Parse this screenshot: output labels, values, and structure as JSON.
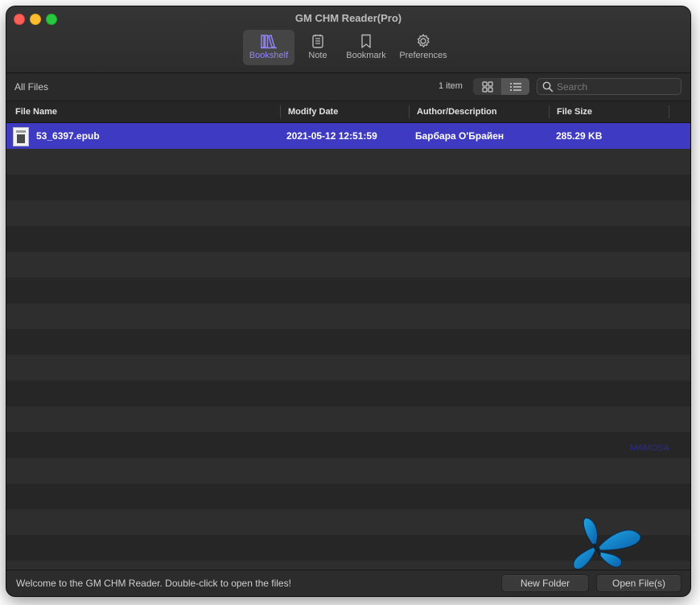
{
  "window": {
    "title": "GM CHM Reader(Pro)"
  },
  "toolbar": {
    "items": [
      {
        "label": "Bookshelf",
        "icon": "bookshelf-icon",
        "active": true
      },
      {
        "label": "Note",
        "icon": "note-icon",
        "active": false
      },
      {
        "label": "Bookmark",
        "icon": "bookmark-icon",
        "active": false
      },
      {
        "label": "Preferences",
        "icon": "gear-icon",
        "active": false
      }
    ]
  },
  "pathbar": {
    "breadcrumb": "All Files",
    "item_count": "1 item",
    "view_modes": [
      "grid-view-icon",
      "list-view-icon"
    ],
    "active_view": "list",
    "search_placeholder": "Search"
  },
  "table": {
    "columns": [
      "File Name",
      "Modify Date",
      "Author/Description",
      "File Size"
    ],
    "rows": [
      {
        "name": "53_6397.epub",
        "modified": "2021-05-12 12:51:59",
        "author": "Барбара О'Брайен",
        "size": "285.29 KB",
        "selected": true
      }
    ]
  },
  "watermark": "MAMOSA",
  "statusbar": {
    "message": "Welcome to the GM CHM Reader. Double-click to open the files!",
    "new_folder": "New Folder",
    "open_files": "Open File(s)"
  },
  "colors": {
    "accent": "#8f84f2",
    "selection": "#3f3ac2",
    "butterfly": "#1e9bd8"
  }
}
